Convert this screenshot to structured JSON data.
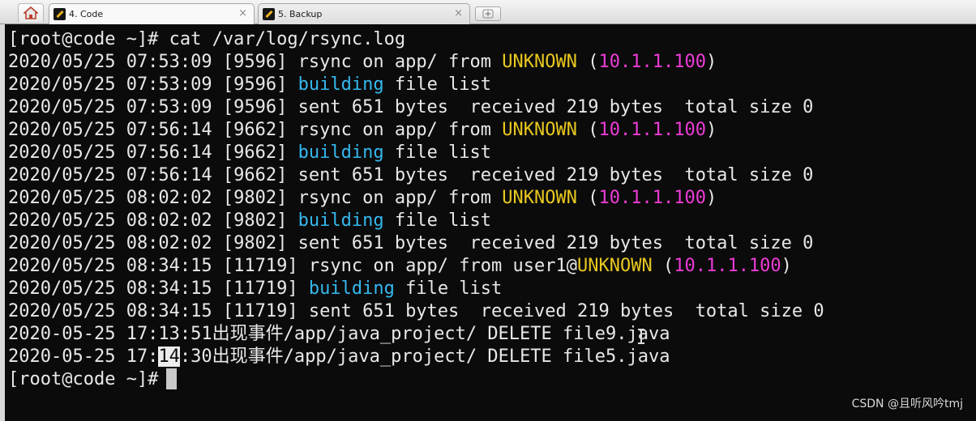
{
  "tabs": [
    {
      "label": "4. Code",
      "close": "×",
      "active": true,
      "icon": "wrench-icon"
    },
    {
      "label": "5. Backup",
      "close": "×",
      "active": false,
      "icon": "wrench-icon"
    }
  ],
  "terminal": {
    "prompt_cmd": "[root@code ~]# cat /var/log/rsync.log",
    "l1": {
      "pre": "2020/05/25 07:53:09 [9596] rsync on app/ from ",
      "user": "UNKNOWN",
      "mid": " (",
      "ip": "10.1.1.100",
      "post": ")"
    },
    "l2": {
      "pre": "2020/05/25 07:53:09 [9596] ",
      "kw": "building",
      "post": " file list"
    },
    "l3": "2020/05/25 07:53:09 [9596] sent 651 bytes  received 219 bytes  total size 0",
    "l4": {
      "pre": "2020/05/25 07:56:14 [9662] rsync on app/ from ",
      "user": "UNKNOWN",
      "mid": " (",
      "ip": "10.1.1.100",
      "post": ")"
    },
    "l5": {
      "pre": "2020/05/25 07:56:14 [9662] ",
      "kw": "building",
      "post": " file list"
    },
    "l6": "2020/05/25 07:56:14 [9662] sent 651 bytes  received 219 bytes  total size 0",
    "l7": {
      "pre": "2020/05/25 08:02:02 [9802] rsync on app/ from ",
      "user": "UNKNOWN",
      "mid": " (",
      "ip": "10.1.1.100",
      "post": ")"
    },
    "l8": {
      "pre": "2020/05/25 08:02:02 [9802] ",
      "kw": "building",
      "post": " file list"
    },
    "l9": "2020/05/25 08:02:02 [9802] sent 651 bytes  received 219 bytes  total size 0",
    "l10": {
      "pre": "2020/05/25 08:34:15 [11719] rsync on app/ from user1@",
      "user": "UNKNOWN",
      "mid": " (",
      "ip": "10.1.1.100",
      "post": ")"
    },
    "l11": {
      "pre": "2020/05/25 08:34:15 [11719] ",
      "kw": "building",
      "post": " file list"
    },
    "l12": "2020/05/25 08:34:15 [11719] sent 651 bytes  received 219 bytes  total size 0",
    "l13": "2020-05-25 17:13:51出现事件/app/java_project/ DELETE file9.java",
    "l14": {
      "pre": "2020-05-25 17:",
      "sel": "14",
      "post": ":30出现事件/app/java_project/ DELETE file5.java"
    },
    "prompt_end": "[root@code ~]#"
  },
  "watermark": "CSDN @且听风吟tmj",
  "colors": {
    "keyword": "#35b8ee",
    "user": "#e8c81f",
    "ip": "#ee3cd7",
    "text": "#e8e8e8",
    "background": "#0b0b0b"
  }
}
